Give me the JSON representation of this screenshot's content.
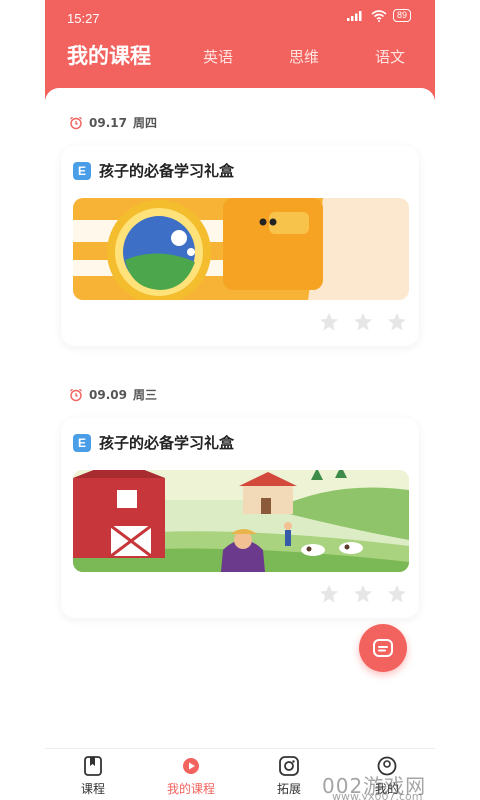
{
  "status_bar": {
    "time": "15:27",
    "signal": "5G",
    "battery": "89"
  },
  "header": {
    "active_tab": "我的课程",
    "tabs": [
      "英语",
      "思维",
      "语文"
    ]
  },
  "lessons": [
    {
      "date": "09.17",
      "weekday": "周四",
      "badge": "E",
      "title": "孩子的必备学习礼盒",
      "stars": 3,
      "stars_earned": 0
    },
    {
      "date": "09.09",
      "weekday": "周三",
      "badge": "E",
      "title": "孩子的必备学习礼盒",
      "stars": 3,
      "stars_earned": 0
    }
  ],
  "bottom_nav": {
    "items": [
      {
        "label": "课程",
        "icon": "book-icon"
      },
      {
        "label": "我的课程",
        "icon": "play-icon"
      },
      {
        "label": "拓展",
        "icon": "expand-icon"
      },
      {
        "label": "我的",
        "icon": "profile-icon"
      }
    ]
  },
  "watermark": "002游戏网",
  "watermark_url": "www.yx007.com",
  "colors": {
    "accent": "#f2625e",
    "star_inactive": "#e6e6e6",
    "badge_blue": "#4a9ee8"
  }
}
